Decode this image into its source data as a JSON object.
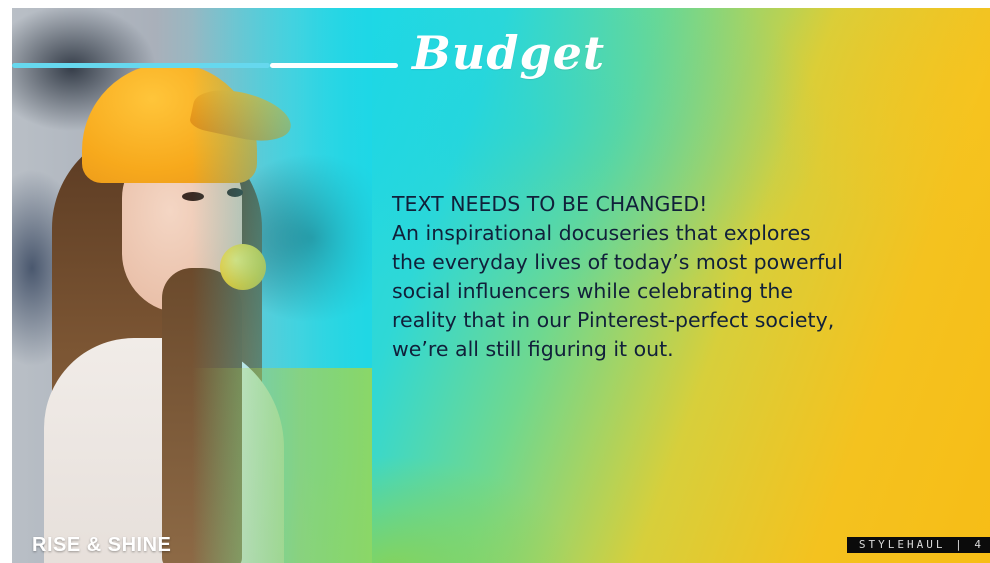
{
  "slide": {
    "title": "Budget",
    "body_lines": [
      "TEXT NEEDS TO BE CHANGED!",
      "An inspirational docuseries that explores",
      "the everyday lives of today’s most powerful",
      "social influencers while celebrating the",
      "reality that in our Pinterest-perfect society,",
      "we’re all still figuring it out."
    ],
    "brand": "RISE & SHINE",
    "page_tag": "STYLEHAUL | 4"
  },
  "colors": {
    "text": "#11203a",
    "accent_cyan": "#0fd6ea",
    "accent_yellow": "#f7bd16",
    "title": "#ffffff"
  },
  "icons": [
    "photo-woman-yellow-cap"
  ]
}
